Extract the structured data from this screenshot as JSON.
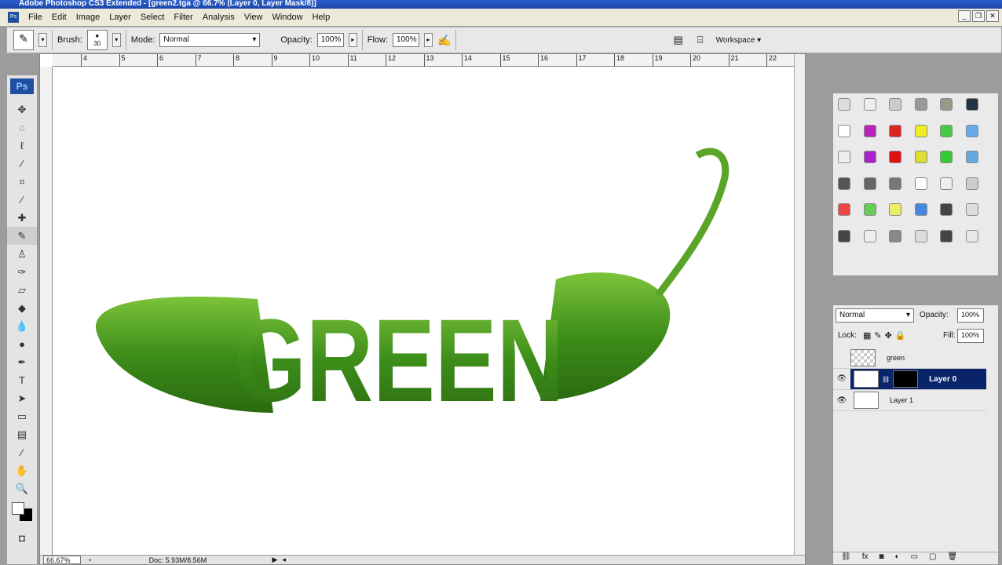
{
  "window": {
    "title": "Adobe Photoshop CS3 Extended - [green2.tga @ 66.7% (Layer 0, Layer Mask/8)]"
  },
  "menu": [
    "File",
    "Edit",
    "Image",
    "Layer",
    "Select",
    "Filter",
    "Analysis",
    "View",
    "Window",
    "Help"
  ],
  "options": {
    "brush_label": "Brush:",
    "brush_size": "30",
    "mode_label": "Mode:",
    "mode_value": "Normal",
    "opacity_label": "Opacity:",
    "opacity_value": "100%",
    "flow_label": "Flow:",
    "flow_value": "100%",
    "workspace_label": "Workspace ▾"
  },
  "toolbox": {
    "logo": "Ps"
  },
  "ruler": [
    "4",
    "5",
    "6",
    "7",
    "8",
    "9",
    "10",
    "11",
    "12",
    "13",
    "14",
    "15",
    "16",
    "17",
    "18",
    "19",
    "20",
    "21",
    "22"
  ],
  "canvas": {
    "artwork_text": "GREEN"
  },
  "status": {
    "zoom": "66.67%",
    "doc": "Doc: 5.93M/8.56M"
  },
  "layers": {
    "blend_mode": "Normal",
    "opacity_label": "Opacity:",
    "opacity_value": "100%",
    "lock_label": "Lock:",
    "fill_label": "Fill:",
    "fill_value": "100%",
    "items": [
      {
        "name": "green",
        "visible": false,
        "selected": false
      },
      {
        "name": "Layer 0",
        "visible": true,
        "selected": true
      },
      {
        "name": "Layer 1",
        "visible": true,
        "selected": false
      }
    ]
  },
  "styles_colors": [
    "#ddd",
    "#eee",
    "#ccc",
    "#999",
    "#998",
    "#234",
    "#fff",
    "#b2b",
    "#d22",
    "#ee2",
    "#4c4",
    "#6ae",
    "#eee",
    "#a2c",
    "#d11",
    "#dd3",
    "#3c3",
    "#6ad",
    "#555",
    "#666",
    "#777",
    "#fff",
    "#eee",
    "#ccc",
    "#e44",
    "#6c5",
    "#ee6",
    "#48d",
    "#444",
    "#ddd",
    "#444",
    "#eee",
    "#888",
    "#ddd",
    "#444",
    "#e8e8e8"
  ]
}
